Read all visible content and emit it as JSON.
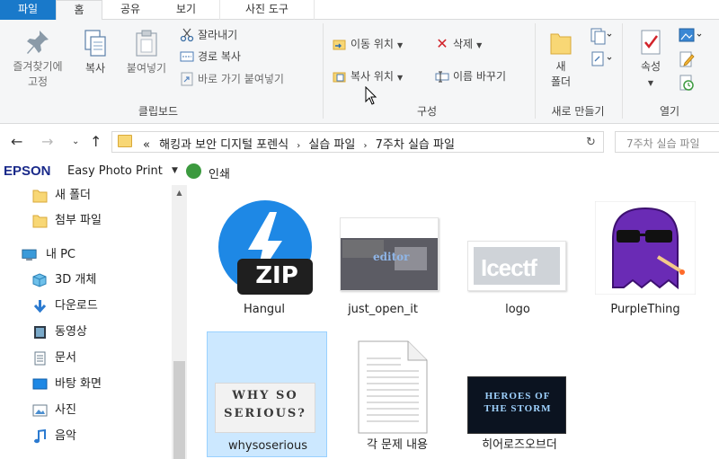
{
  "ribbon_tabs": [
    "파일",
    "홈",
    "공유",
    "보기",
    "사진 도구"
  ],
  "clipboard": {
    "pin_label_1": "즐겨찾기에",
    "pin_label_2": "고정",
    "copy": "복사",
    "paste": "붙여넣기",
    "cut": "잘라내기",
    "copy_path": "경로 복사",
    "paste_shortcut": "바로 가기 붙여넣기",
    "group": "클립보드"
  },
  "organize": {
    "move_to": "이동 위치",
    "copy_to": "복사 위치",
    "delete": "삭제",
    "rename": "이름 바꾸기",
    "group": "구성"
  },
  "new": {
    "new_folder_1": "새",
    "new_folder_2": "폴더",
    "group": "새로 만들기"
  },
  "open": {
    "properties": "속성",
    "group": "열기"
  },
  "address": {
    "prefix": "«",
    "path": [
      "해킹과 보안 디지털 포렌식",
      "실습 파일",
      "7주차 실습 파일"
    ],
    "search_placeholder": "7주차 실습 파일"
  },
  "epson": {
    "logo": "EPSON",
    "app": "Easy Photo Print",
    "print": "인쇄"
  },
  "nav_tree": [
    {
      "label": "새 폴더",
      "icon": "folder-icon"
    },
    {
      "label": "첨부 파일",
      "icon": "folder-icon"
    },
    {
      "label": "내 PC",
      "icon": "pc-icon"
    },
    {
      "label": "3D 개체",
      "icon": "3d-objects-icon"
    },
    {
      "label": "다운로드",
      "icon": "download-icon"
    },
    {
      "label": "동영상",
      "icon": "video-icon"
    },
    {
      "label": "문서",
      "icon": "document-icon"
    },
    {
      "label": "바탕 화면",
      "icon": "desktop-icon"
    },
    {
      "label": "사진",
      "icon": "pictures-icon"
    },
    {
      "label": "음악",
      "icon": "music-icon"
    }
  ],
  "files": [
    {
      "name": "Hangul",
      "thumb_text": "ZIP"
    },
    {
      "name": "just_open_it",
      "thumb_text": "editor"
    },
    {
      "name": "logo",
      "thumb_text": "Icectf"
    },
    {
      "name": "PurpleThing",
      "thumb_text": ""
    },
    {
      "name": "whysoserious",
      "thumb_text": "WHY SO SERIOUS?"
    },
    {
      "name": "각 문제 내용",
      "thumb_text": ""
    },
    {
      "name": "히어로즈오브더",
      "thumb_text": "HEROES OF THE STORM"
    }
  ],
  "colors": {
    "accent": "#1979ca",
    "selection": "#cce8ff",
    "folder": "#f8d775"
  }
}
